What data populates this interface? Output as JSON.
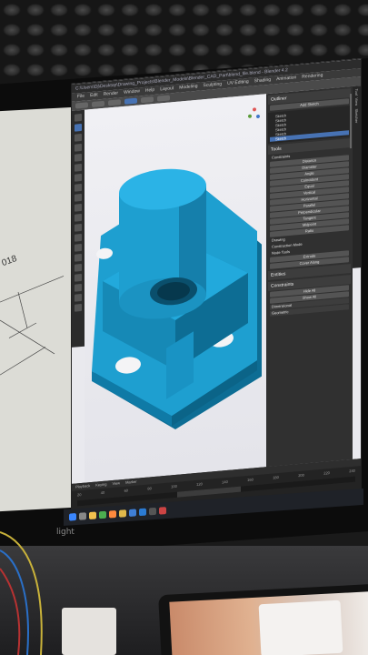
{
  "window": {
    "title": "C:\\Users\\Dj\\Desktop\\Drawing_Projects\\Blender_Models\\Blender_CAD_Part\\blend_file.blend - Blender 4.2",
    "app_label": "Blender 4.2"
  },
  "menubar": {
    "items": [
      "File",
      "Edit",
      "Render",
      "Window",
      "Help",
      "Layout",
      "Modeling",
      "Sculpting",
      "UV Editing",
      "Shading",
      "Animation",
      "Rendering"
    ]
  },
  "outliner": {
    "header": "Outliner",
    "search_placeholder": "Add Sketch",
    "items": [
      "Sketch",
      "Sketch",
      "Sketch",
      "Sketch",
      "Sketch",
      "Sketch"
    ],
    "selected_index": 5
  },
  "tools_panel": {
    "header": "Tools",
    "constraints_label": "Constraints",
    "items": [
      "Distance",
      "Diameter",
      "Angle",
      "Coincident",
      "Equal",
      "Vertical",
      "Horizontal",
      "Parallel",
      "Perpendicular",
      "Tangent",
      "Midpoint",
      "Ratio"
    ],
    "drawing_label": "Drawing",
    "construction_mode": "Construction Mode",
    "nodes_tools_label": "Node Tools",
    "node_tools": [
      "Extrude",
      "Cover Along"
    ],
    "entities_label": "Entities",
    "constraints_section": "Constraints",
    "constraint_items": [
      "Hide All",
      "Show All"
    ],
    "dimensional_label": "Dimensional",
    "geometric_label": "Geometric"
  },
  "sidebar_tabs": [
    "Tool",
    "View",
    "Sketcher"
  ],
  "timeline": {
    "labels": [
      "Playback",
      "Keying",
      "View",
      "Marker"
    ],
    "ruler": [
      "20",
      "40",
      "60",
      "80",
      "100",
      "120",
      "140",
      "160",
      "180",
      "200",
      "220",
      "240"
    ]
  },
  "paper": {
    "text": "018"
  },
  "monitor": {
    "brand": "light"
  },
  "colors": {
    "part_blue": "#1e9fd0",
    "part_dark": "#0d6d94",
    "viewport_bg": "#ececf2",
    "selection": "#4772b3"
  },
  "taskbar_icons": [
    "start-icon",
    "search-icon",
    "file-explorer-icon",
    "chrome-icon",
    "blender-icon",
    "folder-icon",
    "mail-icon",
    "vscode-icon",
    "terminal-icon",
    "app-icon"
  ]
}
